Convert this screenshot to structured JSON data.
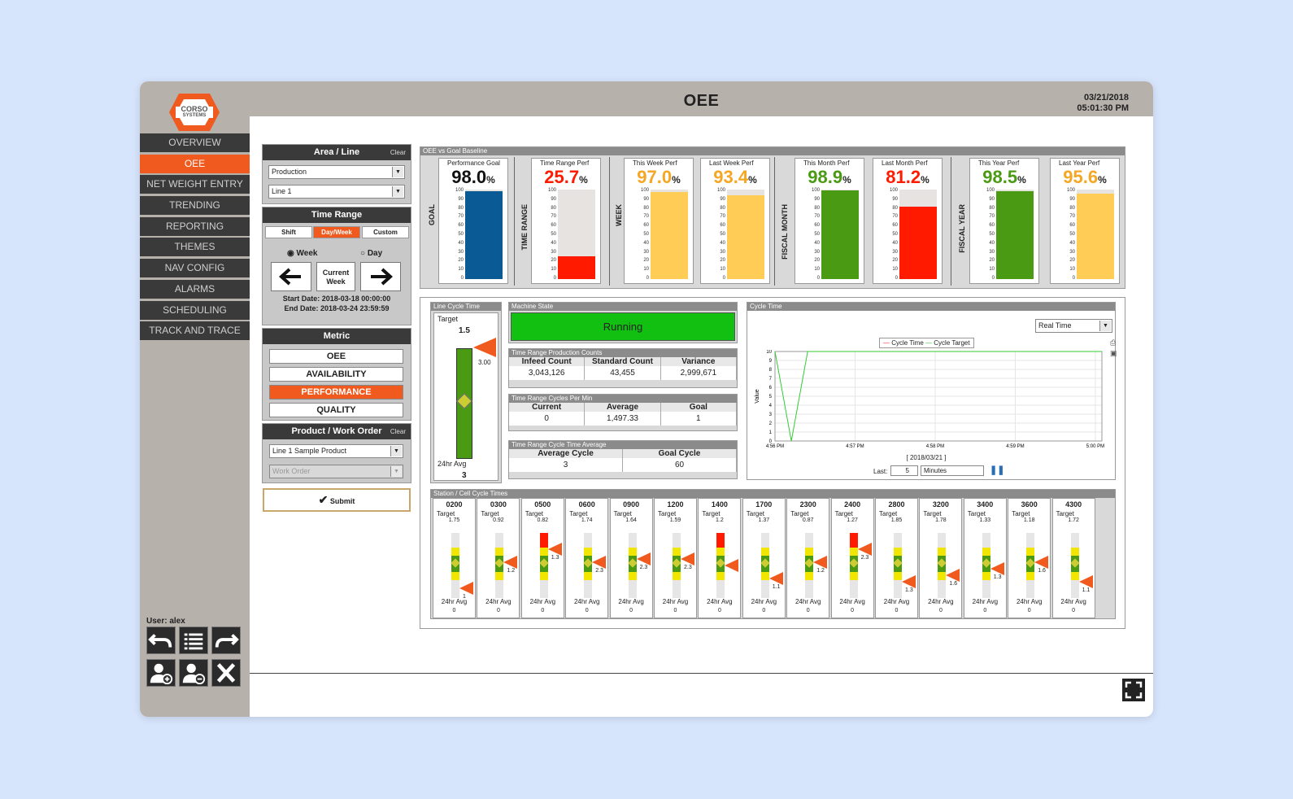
{
  "app": {
    "title": "OEE",
    "date": "03/21/2018",
    "time": "05:01:30 PM",
    "user": "User: alex",
    "logo_top": "CORSO",
    "logo_bottom": "SYSTEMS"
  },
  "nav": [
    "OVERVIEW",
    "OEE",
    "NET WEIGHT ENTRY",
    "TRENDING",
    "REPORTING",
    "THEMES",
    "NAV CONFIG",
    "ALARMS",
    "SCHEDULING",
    "TRACK AND TRACE"
  ],
  "area": {
    "title": "Area / Line",
    "clear": "Clear",
    "area_value": "Production",
    "line_value": "Line 1"
  },
  "time_range": {
    "title": "Time Range",
    "tabs": [
      "Shift",
      "Day/Week",
      "Custom"
    ],
    "week": "Week",
    "day": "Day",
    "current": "Current",
    "current2": "Week",
    "start": "Start Date: 2018-03-18 00:00:00",
    "end": "End Date: 2018-03-24 23:59:59"
  },
  "metric": {
    "title": "Metric",
    "items": [
      "OEE",
      "AVAILABILITY",
      "PERFORMANCE",
      "QUALITY"
    ]
  },
  "product": {
    "title": "Product / Work Order",
    "clear": "Clear",
    "product_value": "Line 1 Sample Product",
    "work_order_placeholder": "Work Order",
    "submit": "Submit"
  },
  "goal_section": {
    "title": "OEE vs Goal Baseline",
    "groups": [
      "GOAL",
      "TIME RANGE",
      "WEEK",
      "FISCAL MONTH",
      "FISCAL YEAR"
    ],
    "cards": [
      {
        "label": "Performance Goal",
        "value": "98.0",
        "pct": 98.0,
        "color": "#0a5a96",
        "text_color": "#111"
      },
      {
        "label": "Time Range Perf",
        "value": "25.7",
        "pct": 25.7,
        "color": "#ff1a00",
        "text_color": "#ff1a00"
      },
      {
        "label": "This Week Perf",
        "value": "97.0",
        "pct": 97.0,
        "color": "#ffcc55",
        "text_color": "#f5a623"
      },
      {
        "label": "Last Week Perf",
        "value": "93.4",
        "pct": 93.4,
        "color": "#ffcc55",
        "text_color": "#f5a623"
      },
      {
        "label": "This Month Perf",
        "value": "98.9",
        "pct": 98.9,
        "color": "#4a9a14",
        "text_color": "#4a9a14"
      },
      {
        "label": "Last Month Perf",
        "value": "81.2",
        "pct": 81.2,
        "color": "#ff1a00",
        "text_color": "#ff1a00"
      },
      {
        "label": "This Year Perf",
        "value": "98.5",
        "pct": 98.5,
        "color": "#4a9a14",
        "text_color": "#4a9a14"
      },
      {
        "label": "Last Year Perf",
        "value": "95.6",
        "pct": 95.6,
        "color": "#ffcc55",
        "text_color": "#f5a623"
      }
    ],
    "ticks": [
      "100",
      "90",
      "80",
      "70",
      "60",
      "50",
      "40",
      "30",
      "20",
      "10",
      "0"
    ]
  },
  "line_cycle": {
    "title": "Line Cycle Time",
    "target_label": "Target",
    "target": "1.5",
    "marker": "3.00",
    "avg_label": "24hr Avg",
    "avg": "3"
  },
  "machine_state": {
    "title": "Machine State",
    "value": "Running"
  },
  "counts": {
    "title": "Time Range Production Counts",
    "headers": [
      "Infeed Count",
      "Standard Count",
      "Variance"
    ],
    "values": [
      "3,043,126",
      "43,455",
      "2,999,671"
    ]
  },
  "cycles": {
    "title": "Time Range Cycles Per Min",
    "headers": [
      "Current",
      "Average",
      "Goal"
    ],
    "values": [
      "0",
      "1,497.33",
      "1"
    ]
  },
  "cycle_avg": {
    "title": "Time Range Cycle Time Average",
    "headers": [
      "Average Cycle",
      "Goal Cycle"
    ],
    "values": [
      "3",
      "60"
    ]
  },
  "cycle_chart": {
    "title": "Cycle Time",
    "mode": "Real Time",
    "legend": [
      "Cycle Time",
      "Cycle Target"
    ],
    "ylabel": "Value",
    "xdate": "[ 2018/03/21 ]",
    "last_label": "Last:",
    "last_value": "5",
    "unit": "Minutes"
  },
  "chart_data": {
    "type": "line",
    "x": [
      "4:56 PM",
      "4:57 PM",
      "4:58 PM",
      "4:59 PM",
      "5:00 PM"
    ],
    "y_ticks": [
      "0",
      "1",
      "2",
      "3",
      "4",
      "5",
      "6",
      "7",
      "8",
      "9",
      "10"
    ],
    "ylim": [
      0,
      10
    ],
    "series": [
      {
        "name": "Cycle Time",
        "values": []
      },
      {
        "name": "Cycle Target",
        "points": [
          [
            0,
            10
          ],
          [
            0.05,
            0
          ],
          [
            0.1,
            10
          ],
          [
            1,
            10
          ]
        ]
      }
    ],
    "xlabel": "[ 2018/03/21 ]",
    "ylabel": "Value",
    "legend": "top-center",
    "grid": true
  },
  "stations": {
    "title": "Station / Cell Cycle Times",
    "target_label": "Target",
    "avg_label": "24hr Avg",
    "items": [
      {
        "code": "0200",
        "target": "1.75",
        "avg": "0",
        "marker": "1",
        "mk": 0.15,
        "red": false
      },
      {
        "code": "0300",
        "target": "0.92",
        "avg": "0",
        "marker": "1.2",
        "mk": 0.55,
        "red": false
      },
      {
        "code": "0500",
        "target": "0.82",
        "avg": "0",
        "marker": "1.3",
        "mk": 0.75,
        "red": true
      },
      {
        "code": "0600",
        "target": "1.74",
        "avg": "0",
        "marker": "2.3",
        "mk": 0.55,
        "red": false
      },
      {
        "code": "0900",
        "target": "1.64",
        "avg": "0",
        "marker": "2.3",
        "mk": 0.6,
        "red": false
      },
      {
        "code": "1200",
        "target": "1.59",
        "avg": "0",
        "marker": "2.3",
        "mk": 0.6,
        "red": false
      },
      {
        "code": "1400",
        "target": "1.2",
        "avg": "0",
        "marker": "",
        "mk": 0.5,
        "red": true
      },
      {
        "code": "1700",
        "target": "1.37",
        "avg": "0",
        "marker": "1.1",
        "mk": 0.3,
        "red": false
      },
      {
        "code": "2300",
        "target": "0.87",
        "avg": "0",
        "marker": "1.2",
        "mk": 0.55,
        "red": false
      },
      {
        "code": "2400",
        "target": "1.27",
        "avg": "0",
        "marker": "2.3",
        "mk": 0.75,
        "red": true
      },
      {
        "code": "2800",
        "target": "1.85",
        "avg": "0",
        "marker": "1.3",
        "mk": 0.25,
        "red": false
      },
      {
        "code": "3200",
        "target": "1.78",
        "avg": "0",
        "marker": "1.6",
        "mk": 0.35,
        "red": false
      },
      {
        "code": "3400",
        "target": "1.33",
        "avg": "0",
        "marker": "1.3",
        "mk": 0.45,
        "red": false
      },
      {
        "code": "3600",
        "target": "1.18",
        "avg": "0",
        "marker": "1.6",
        "mk": 0.55,
        "red": false
      },
      {
        "code": "4300",
        "target": "1.72",
        "avg": "0",
        "marker": "1.1",
        "mk": 0.25,
        "red": false
      }
    ]
  }
}
